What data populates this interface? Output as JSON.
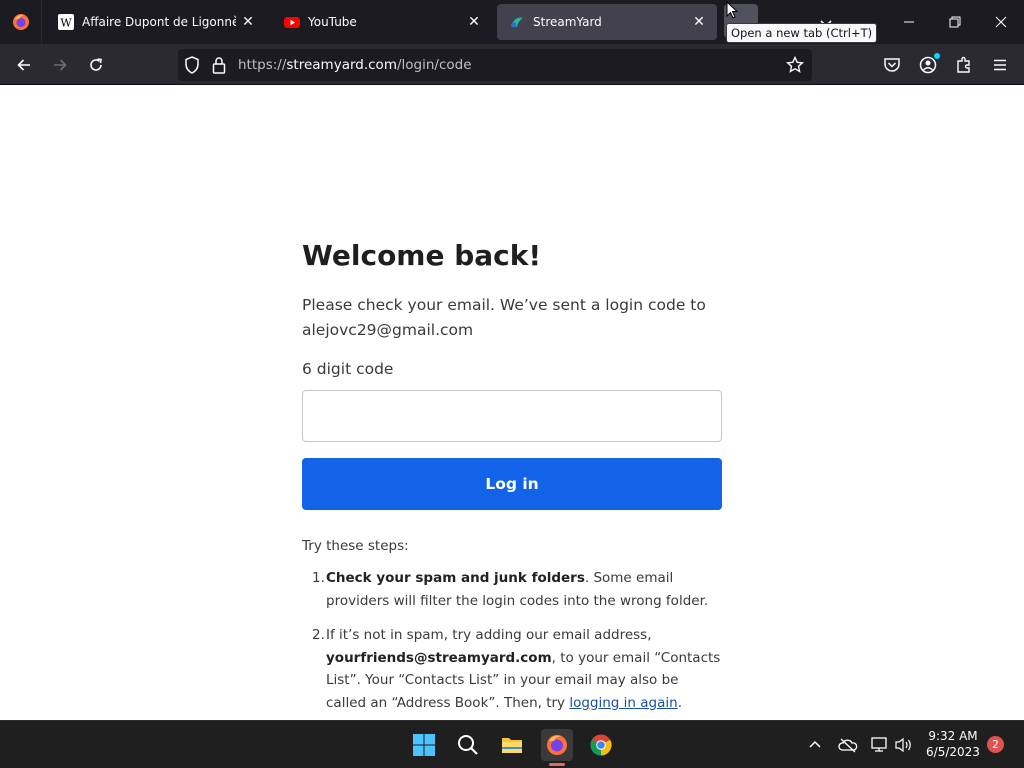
{
  "browser": {
    "tabs": [
      {
        "title": "Affaire Dupont de Ligonnès — W",
        "favicon": "wikipedia-icon"
      },
      {
        "title": "YouTube",
        "favicon": "youtube-icon"
      },
      {
        "title": "StreamYard",
        "favicon": "streamyard-icon",
        "active": true
      }
    ],
    "tooltip": "Open a new tab (Ctrl+T)",
    "url_prefix": "https://",
    "url_host": "streamyard.com",
    "url_path": "/login/code"
  },
  "page": {
    "heading": "Welcome back!",
    "intro": "Please check your email. We’ve sent a login code to alejovc29@gmail.com",
    "code_label": "6 digit code",
    "code_value": "",
    "login_button": "Log in",
    "steps_title": "Try these steps:",
    "step1": {
      "num": "1.",
      "bold": "Check your spam and junk folders",
      "rest": ". Some email providers will filter the login codes into the wrong folder."
    },
    "step2": {
      "num": "2.",
      "text_a": "If it’s not in spam, try adding our email address, ",
      "bold": "yourfriends@streamyard.com",
      "text_b": ", to your email “Contacts List”. Your “Contacts List” in your email may also be called an “Address Book”. Then, try ",
      "link": "logging in again",
      "text_c": "."
    }
  },
  "taskbar": {
    "time": "9:32 AM",
    "date": "6/5/2023",
    "notifications": "2"
  },
  "colors": {
    "primary_button": "#1363e8",
    "tab_strip": "#1c1b22",
    "toolbar": "#2b2a33",
    "taskbar": "#1f1f1f"
  }
}
